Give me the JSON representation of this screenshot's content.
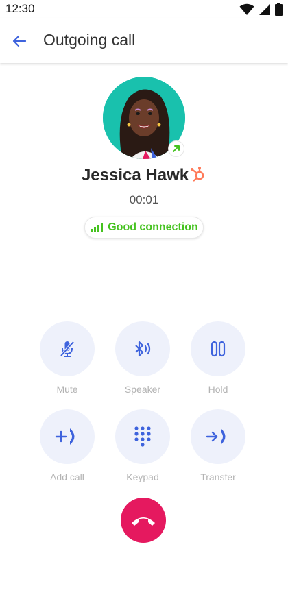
{
  "status_bar": {
    "time": "12:30"
  },
  "header": {
    "title": "Outgoing call"
  },
  "caller": {
    "name": "Jessica Hawk",
    "timer": "00:01"
  },
  "connection": {
    "label": "Good connection",
    "color": "#45c21f"
  },
  "controls": [
    {
      "label": "Mute",
      "icon": "mic-off-icon"
    },
    {
      "label": "Speaker",
      "icon": "bluetooth-audio-icon"
    },
    {
      "label": "Hold",
      "icon": "pause-icon"
    },
    {
      "label": "Add call",
      "icon": "add-call-icon"
    },
    {
      "label": "Keypad",
      "icon": "dialpad-icon"
    },
    {
      "label": "Transfer",
      "icon": "transfer-icon"
    }
  ],
  "colors": {
    "accent": "#3e63dd",
    "control_bg": "#eef1fb",
    "end_call": "#e5195f",
    "hubspot": "#ff7a59",
    "avatar_bg": "#19c1ad"
  }
}
